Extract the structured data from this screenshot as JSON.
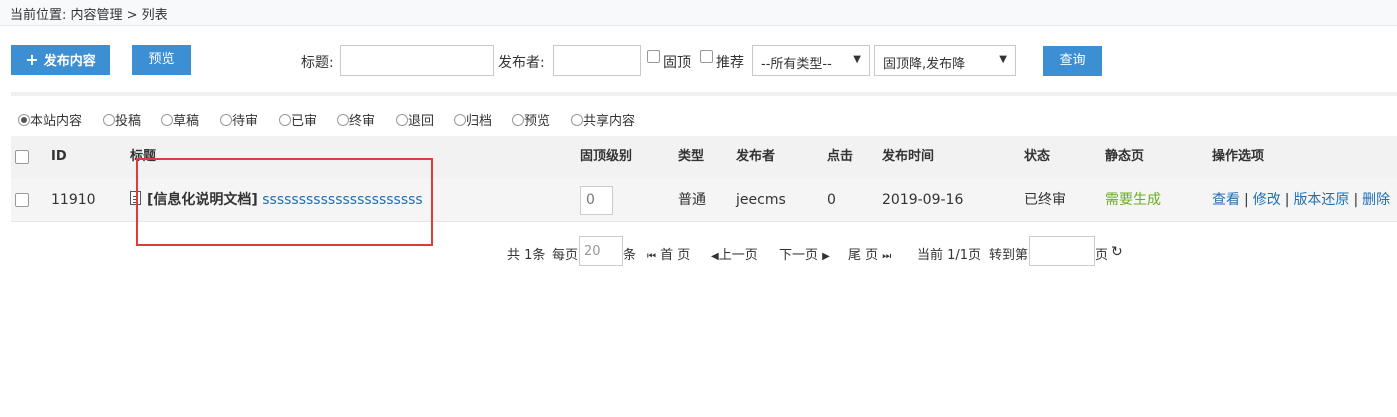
{
  "breadcrumb": "当前位置: 内容管理 > 列表",
  "toolbar": {
    "publish_label": "发布内容",
    "preview_label": "预览",
    "title_label": "标题:",
    "publisher_label": "发布者:",
    "top_label": "固顶",
    "recommend_label": "推荐",
    "type_select": "--所有类型--",
    "sort_select": "固顶降,发布降",
    "query_label": "查询"
  },
  "filters": [
    "本站内容",
    "投稿",
    "草稿",
    "待审",
    "已审",
    "终审",
    "退回",
    "归档",
    "预览",
    "共享内容"
  ],
  "table": {
    "headers": [
      "ID",
      "标题",
      "固顶级别",
      "类型",
      "发布者",
      "点击",
      "发布时间",
      "状态",
      "静态页",
      "操作选项"
    ],
    "rows": [
      {
        "id": "11910",
        "category": "[信息化说明文档]",
        "title": "ssssssssssssssssssssss",
        "top_level": "0",
        "type": "普通",
        "publisher": "jeecms",
        "clicks": "0",
        "date": "2019-09-16",
        "status": "已终审",
        "static_page": "需要生成",
        "ops": [
          "查看",
          "修改",
          "版本还原",
          "删除"
        ]
      }
    ]
  },
  "pager": {
    "total": "共 1条",
    "per_page_label": "每页",
    "per_page_value": "20",
    "unit": "条",
    "first": "首 页",
    "prev": "上一页",
    "next": "下一页",
    "last": "尾 页",
    "current": "当前 1/1页",
    "goto": "转到第",
    "page_suffix": "页"
  },
  "colors": {
    "accent": "#3d8fd3",
    "highlight": "#e03a3a",
    "link": "#1f6fb7",
    "green": "#6aae1f"
  }
}
